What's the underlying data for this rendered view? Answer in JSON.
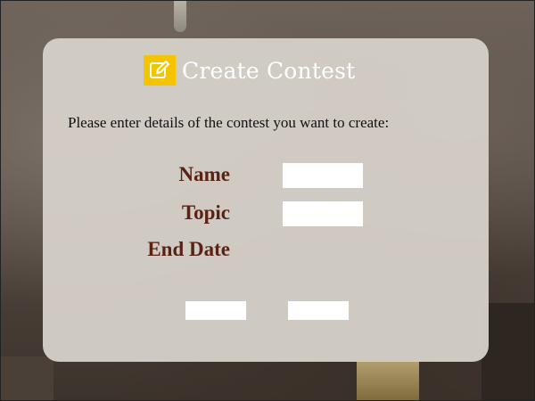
{
  "header": {
    "title": "Create Contest",
    "icon": "edit-icon",
    "icon_color": "#f2c500"
  },
  "form": {
    "instructions": "Please enter details of the contest you want to create:",
    "name_label": "Name",
    "topic_label": "Topic",
    "end_date_label": "End Date",
    "name_value": "",
    "topic_value": ""
  },
  "buttons": {
    "primary_label": "",
    "secondary_label": ""
  },
  "colors": {
    "label": "#5a2212",
    "card": "#d4cfc8"
  }
}
